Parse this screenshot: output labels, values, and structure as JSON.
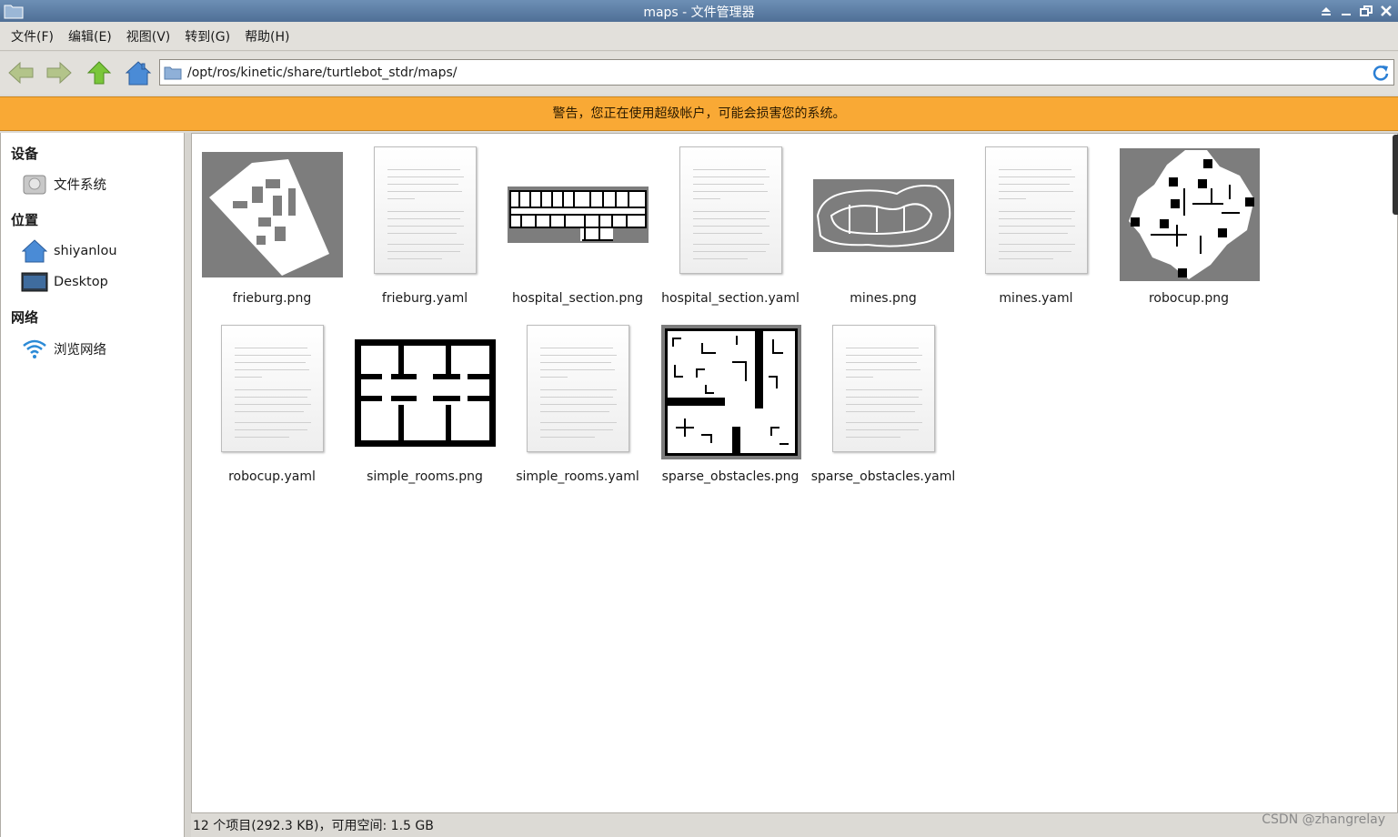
{
  "window": {
    "title": "maps - 文件管理器"
  },
  "menu": [
    "文件(F)",
    "编辑(E)",
    "视图(V)",
    "转到(G)",
    "帮助(H)"
  ],
  "toolbar": {
    "path": "/opt/ros/kinetic/share/turtlebot_stdr/maps/"
  },
  "warning": "警告，您正在使用超级帐户，可能会损害您的系统。",
  "sidebar": {
    "devices_heading": "设备",
    "filesystem": "文件系统",
    "places_heading": "位置",
    "home": "shiyanlou",
    "desktop": "Desktop",
    "network_heading": "网络",
    "browse_network": "浏览网络"
  },
  "files": [
    {
      "name": "frieburg.png",
      "kind": "map"
    },
    {
      "name": "frieburg.yaml",
      "kind": "text"
    },
    {
      "name": "hospital_section.png",
      "kind": "map"
    },
    {
      "name": "hospital_section.yaml",
      "kind": "text"
    },
    {
      "name": "mines.png",
      "kind": "map"
    },
    {
      "name": "mines.yaml",
      "kind": "text"
    },
    {
      "name": "robocup.png",
      "kind": "map"
    },
    {
      "name": "robocup.yaml",
      "kind": "text"
    },
    {
      "name": "simple_rooms.png",
      "kind": "map"
    },
    {
      "name": "simple_rooms.yaml",
      "kind": "text"
    },
    {
      "name": "sparse_obstacles.png",
      "kind": "map"
    },
    {
      "name": "sparse_obstacles.yaml",
      "kind": "text"
    }
  ],
  "status": "12 个项目(292.3 KB)，可用空间: 1.5 GB",
  "watermark": "CSDN @zhangrelay",
  "colors": {
    "warning_bg": "#f9a935",
    "titlebar": "#5b7ca3",
    "map_gray": "#7d7d7d"
  }
}
